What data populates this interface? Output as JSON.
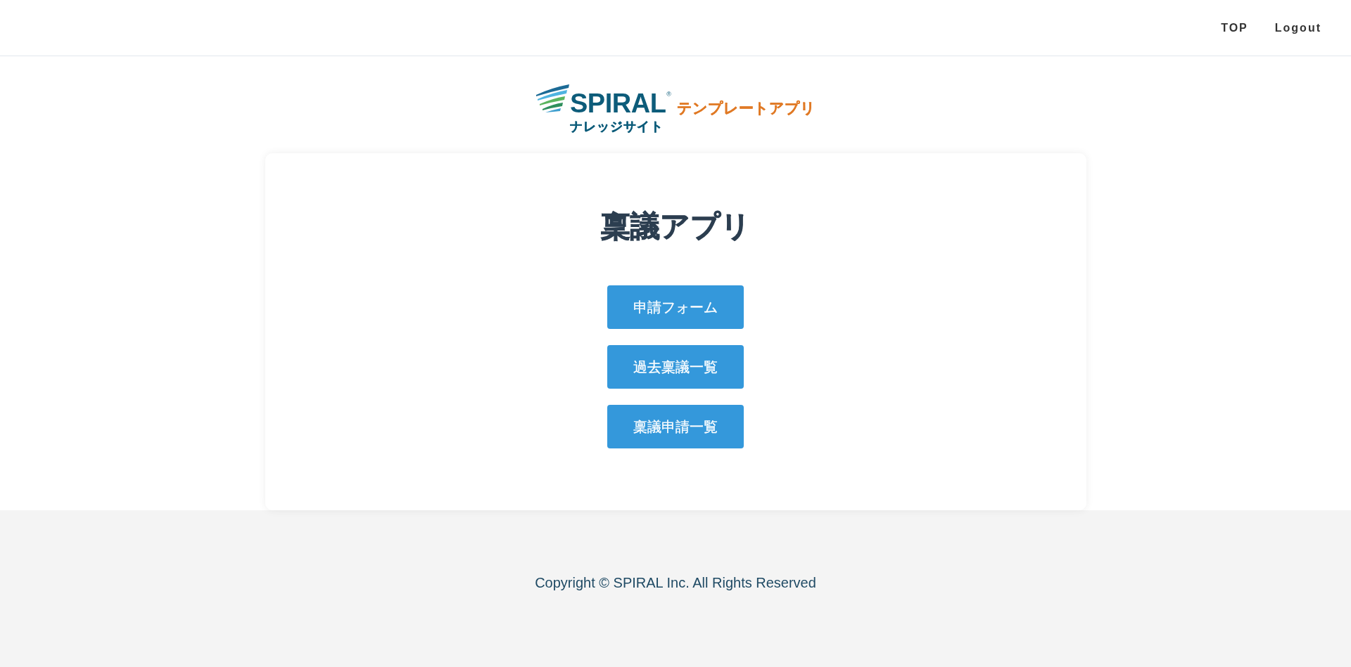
{
  "header": {
    "nav": [
      "TOP",
      "Logout"
    ]
  },
  "logo": {
    "brand": "SPIRAL",
    "registered": "®",
    "subtitle": "ナレッジサイト",
    "tagline": "テンプレートアプリ"
  },
  "card": {
    "title": "稟議アプリ",
    "buttons": [
      "申請フォーム",
      "過去稟議一覧",
      "稟議申請一覧"
    ]
  },
  "footer": {
    "copyright": "Copyright © SPIRAL Inc. All Rights Reserved"
  }
}
